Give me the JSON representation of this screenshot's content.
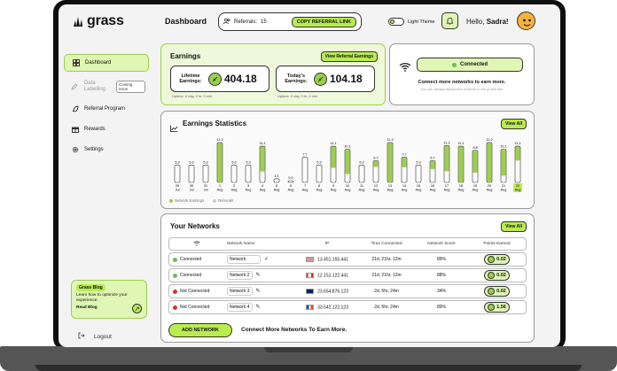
{
  "brand": {
    "name": "grass"
  },
  "sidebar": {
    "items": [
      {
        "label": "Dashboard",
        "icon": "grid-icon",
        "active": true
      },
      {
        "label": "Data Labelling",
        "icon": "pen-icon",
        "badge": "Coming Soon",
        "disabled": true
      },
      {
        "label": "Referral Program",
        "icon": "rocket-icon"
      },
      {
        "label": "Rewards",
        "icon": "gift-icon"
      },
      {
        "label": "Settings",
        "icon": "gear-icon"
      }
    ],
    "blog": {
      "title": "Grass Blog",
      "desc": "Learn how to optimize your experience.",
      "link": "Read Blog"
    },
    "logout": "Logout"
  },
  "header": {
    "title": "Dashboard",
    "referrals_label": "Referrals:",
    "referrals_count": "15",
    "copy_button": "COPY REFERRAL LINK",
    "theme_label": "Light Theme",
    "greeting": "Hello,",
    "user": "Sadra!"
  },
  "earnings": {
    "title": "Earnings",
    "view_button": "View Referral Earnings",
    "lifetime_label": "Lifetime Earnings:",
    "lifetime_value": "404.18",
    "today_label": "Today's Earnings:",
    "today_value": "104.18",
    "uptime1": "Uptime: 0 day, 0 hr, 0 min",
    "uptime2": "Uptime: 0 day, 0 hr, 0 min"
  },
  "connection": {
    "status": "Connected",
    "message": "Connect more networks to earn more.",
    "sub": "You can always disconnect network in the profile tab."
  },
  "stats": {
    "title": "Earnings Statistics",
    "view_button": "View All",
    "legend": [
      "Network Earnings",
      "Referrals"
    ]
  },
  "chart_data": {
    "type": "bar",
    "categories": [
      "29 Jul",
      "30 Jul",
      "31 Jul",
      "1 Aug",
      "2 Aug",
      "3 Aug",
      "4 Aug",
      "5 Aug",
      "6 Aug",
      "7 Aug",
      "8 Aug",
      "9 Aug",
      "10 Aug",
      "11 Aug",
      "12 Aug",
      "13 Aug",
      "14 Aug",
      "15 Aug",
      "16 Aug",
      "17 Aug",
      "18 Aug",
      "19 Aug",
      "20 Aug",
      "21 Aug",
      "22 Aug"
    ],
    "category_labels_top": [
      "29",
      "30",
      "31",
      "1",
      "2",
      "3",
      "4",
      "5",
      "6",
      "7",
      "8",
      "9",
      "10",
      "11",
      "12",
      "13",
      "14",
      "15",
      "16",
      "17",
      "18",
      "19",
      "20",
      "21",
      "22"
    ],
    "category_labels_bottom": [
      "Jul",
      "Jul",
      "Jul",
      "Aug",
      "Aug",
      "Aug",
      "Aug",
      "Aug",
      "Aug",
      "Aug",
      "Aug",
      "Aug",
      "Aug",
      "Aug",
      "Aug",
      "Aug",
      "Aug",
      "Aug",
      "Aug",
      "Aug",
      "Aug",
      "Aug",
      "Aug",
      "Aug",
      "Aug"
    ],
    "series": [
      {
        "name": "Network Earnings",
        "values": [
          5.3,
          5.3,
          5.3,
          12.2,
          5.3,
          5.3,
          11.1,
          1.1,
          0.0,
          7.7,
          5.3,
          11.1,
          10.1,
          5.3,
          6.7,
          12.2,
          7.7,
          5.3,
          6.7,
          11.3,
          11.1,
          9.8,
          12.2,
          10.1,
          11.1
        ]
      }
    ],
    "labels": [
      "5.3",
      "5.3",
      "5.3",
      "12.2",
      "5.3",
      "5.3",
      "11.1",
      "1.1",
      "0.0",
      "7.7",
      "5.3",
      "11.1",
      "10.1",
      "5.3",
      "6.7",
      "12.2",
      "7.7",
      "5.3",
      "6.7",
      "11.3",
      "11.1",
      "9.8",
      "12.2",
      "10.1",
      "11.1"
    ],
    "green_portion": [
      0,
      0,
      0,
      1,
      0,
      0,
      0.7,
      0,
      0,
      0,
      0,
      0.6,
      0.75,
      0,
      0.3,
      1,
      0.4,
      0,
      0.4,
      0.7,
      1,
      0.7,
      1,
      0.8,
      0.4
    ],
    "ylim": [
      0,
      13
    ]
  },
  "networks": {
    "title": "Your Networks",
    "view_button": "View All",
    "columns": [
      "",
      "Network Name",
      "IP",
      "Time Connected",
      "Network Score",
      "Points Earned"
    ],
    "rows": [
      {
        "status": "Connected",
        "name": "Network",
        "ip": "13.451.155.441",
        "time": "21d, 21hr, 12m",
        "score": "89%",
        "points": "0.02",
        "connected": true,
        "flag": "us"
      },
      {
        "status": "Connected",
        "name": "Network 2",
        "ip": "12.151.122.441",
        "time": "21d, 21hr, 12m",
        "score": "88%",
        "points": "0.02",
        "connected": true,
        "flag": "ca"
      },
      {
        "status": "Not Connected",
        "name": "Network 3",
        "ip": "23.654.876.123",
        "time": "2d, 5hr, 24m",
        "score": "34%",
        "points": "0.02",
        "connected": false,
        "flag": "uk"
      },
      {
        "status": "Not Connected",
        "name": "Network 4",
        "ip": "33.542.122.123",
        "time": "2d, 5hr, 24m",
        "score": "89%",
        "points": "1.56",
        "connected": false,
        "flag": "fr"
      }
    ],
    "add_button": "ADD NETWORK",
    "add_message": "Connect More Networks To Earn More."
  },
  "colors": {
    "accent": "#b9ec4f",
    "accent_light": "#dff6b5",
    "connected": "#6cc04a",
    "disconnected": "#d9303d"
  }
}
